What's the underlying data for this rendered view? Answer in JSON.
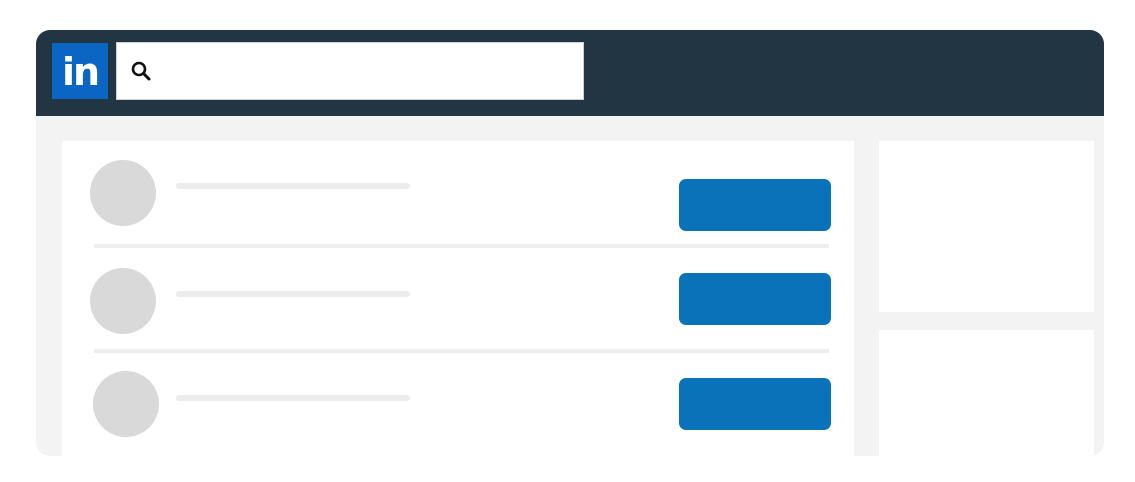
{
  "app": {
    "logo_text": "in",
    "brand_color": "#0a66c2",
    "topbar_color": "#213542"
  },
  "search": {
    "value": "",
    "placeholder": "",
    "icon": "search-icon"
  },
  "results": [
    {
      "name": "",
      "action_label": ""
    },
    {
      "name": "",
      "action_label": ""
    },
    {
      "name": "",
      "action_label": ""
    }
  ],
  "colors": {
    "action_button": "#0a72b8",
    "avatar_placeholder": "#d9d9d9",
    "page_background": "#f3f3f3"
  }
}
